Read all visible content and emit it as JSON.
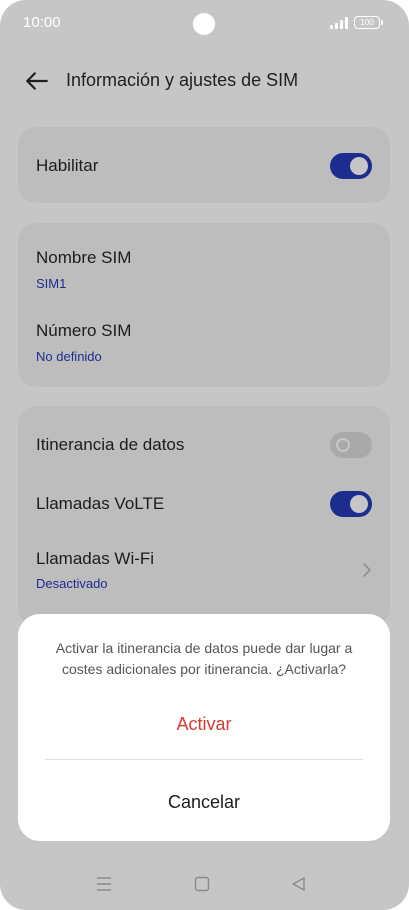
{
  "status_bar": {
    "time": "10:00",
    "battery": "100"
  },
  "header": {
    "title": "Información y ajustes de SIM",
    "back_icon": "arrow-left-icon"
  },
  "enable_card": {
    "label": "Habilitar",
    "toggle_state": "on"
  },
  "sim_card": {
    "name_label": "Nombre SIM",
    "name_value": "SIM1",
    "number_label": "Número SIM",
    "number_value": "No definido"
  },
  "settings_card": {
    "roaming_label": "Itinerancia de datos",
    "roaming_state": "off",
    "volte_label": "Llamadas VoLTE",
    "volte_state": "on",
    "wifi_label": "Llamadas Wi-Fi",
    "wifi_value": "Desactivado"
  },
  "dialog": {
    "message": "Activar la itinerancia de datos puede dar lugar a costes adicionales por itinerancia. ¿Activarla?",
    "confirm_label": "Activar",
    "cancel_label": "Cancelar"
  },
  "colors": {
    "accent": "#1d2c8f",
    "danger": "#d83a31",
    "overlay_background": "#c6c6c6",
    "dialog_background": "#ffffff"
  },
  "nav_bar": {
    "icons": [
      "menu-icon",
      "home-icon",
      "back-triangle-icon"
    ]
  }
}
